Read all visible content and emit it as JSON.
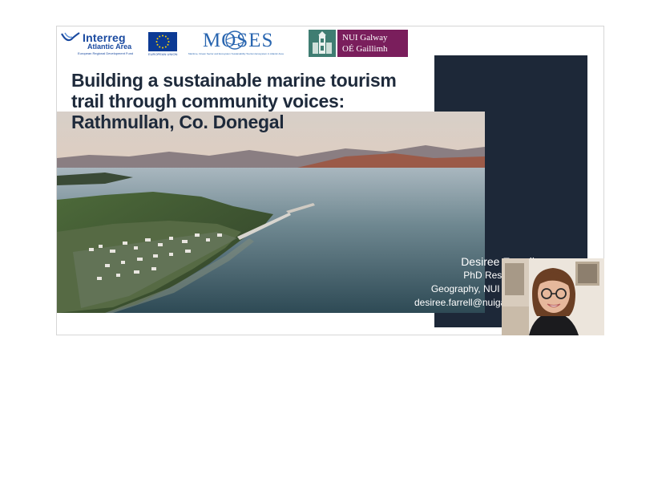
{
  "slide": {
    "title_lines": [
      "Building a sustainable marine tourism",
      "trail through community voices:",
      "Rathmullan, Co. Donegal"
    ],
    "presenter": {
      "name": "Desiree Farrell",
      "role": "PhD Researcher",
      "affiliation": "Geography, NUI Galway",
      "email": "desiree.farrell@nuigalway.ie"
    }
  },
  "logos": {
    "interreg": {
      "brand": "Interreg",
      "region": "Atlantic Area",
      "fund": "European Regional Development Fund"
    },
    "eu": {
      "caption": "EUROPEAN UNION"
    },
    "moses": {
      "wordmark": "MOSES",
      "tagline": "Maritime, Ocean Sector and Ecosystem Sustainability Tourism Ecosystem in Atlantic Area"
    },
    "nui": {
      "english": "NUI Galway",
      "irish": "OÉ Gaillimh"
    }
  },
  "colors": {
    "title_text": "#1e2a3b",
    "navy_panel": "#1d2838",
    "nui_brand": "#7a1e5c",
    "interreg_blue": "#1a4aa0",
    "moses_blue": "#2a66b0"
  },
  "icons": {
    "interreg_logo": "interreg-swoosh-icon",
    "eu_flag": "eu-flag-icon",
    "moses_logo": "moses-globe-icon",
    "nui_crest": "nui-quadrangle-tower-icon"
  }
}
